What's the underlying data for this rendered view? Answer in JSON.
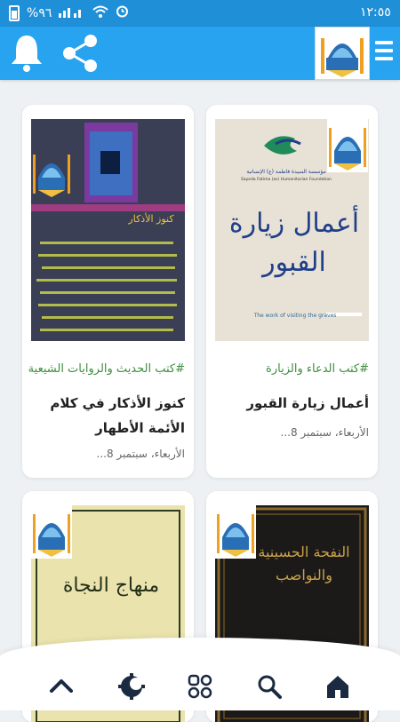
{
  "status_bar": {
    "time": "١٢:٥٥",
    "battery": "%٩٦"
  },
  "app_bar": {
    "icons": [
      "bell-icon",
      "share-icon",
      "mosque-logo",
      "menu-icon"
    ],
    "accent": "#27a3f0"
  },
  "cards": [
    {
      "category": "#كتب الدعاء والزيارة",
      "title": "أعمال زيارة القبور",
      "date": "الأربعاء، سبتمبر 8...",
      "cover_text": "أعمال زيارة القبور",
      "cover_org": "مؤسسة السيدة فاطمة (ع) الإنسانية",
      "cover_org_en": "Sayeda Fatima (as) Humanitarian Foundation",
      "cover_sub": "The work of visiting the graves"
    },
    {
      "category": "#كتب الحديث والروايات الشيعية",
      "title": "كنوز الأذكار في كلام الأئمة الأطهار",
      "date": "الأربعاء، سبتمبر 8...",
      "cover_text": "كنوز الأذكار"
    },
    {
      "cover_text": "النفحة الحسينية والنواصب"
    },
    {
      "cover_text": "منهاج النجاة"
    }
  ],
  "bottom_nav": [
    "chevron-up-icon",
    "moon-icon",
    "apps-icon",
    "search-icon",
    "home-icon"
  ]
}
